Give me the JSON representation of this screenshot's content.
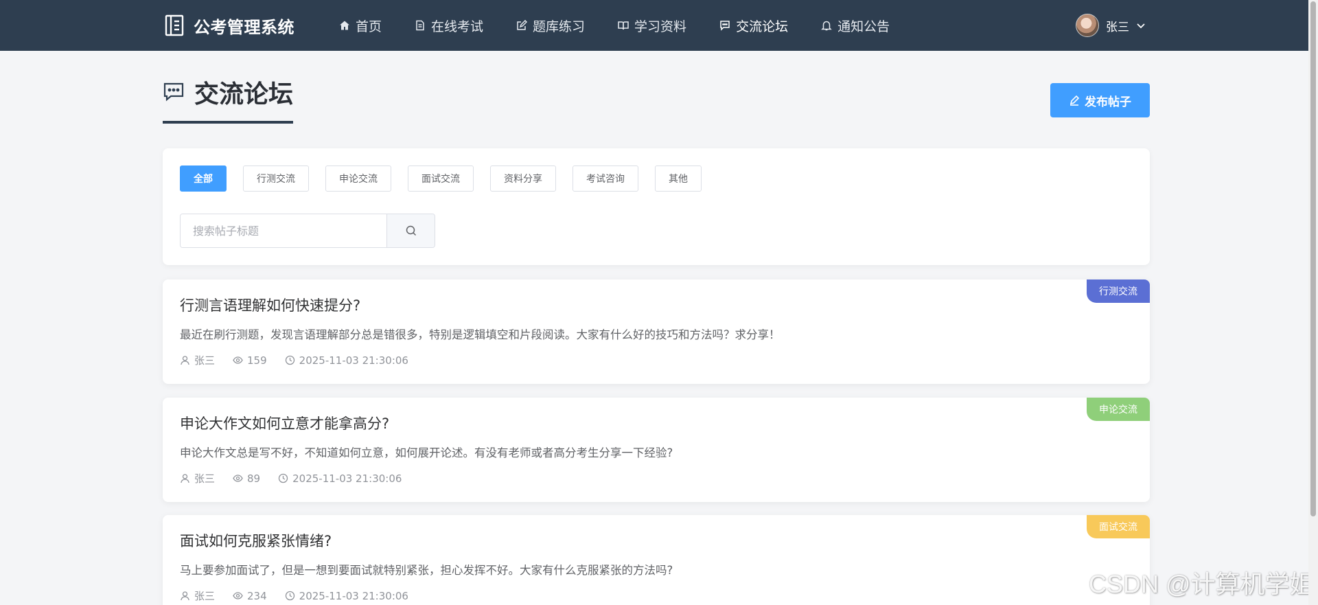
{
  "header": {
    "brand": "公考管理系统",
    "nav": [
      {
        "label": "首页",
        "icon": "home-icon"
      },
      {
        "label": "在线考试",
        "icon": "document-icon"
      },
      {
        "label": "题库练习",
        "icon": "edit-icon"
      },
      {
        "label": "学习资料",
        "icon": "book-icon"
      },
      {
        "label": "交流论坛",
        "icon": "chat-icon",
        "active": true
      },
      {
        "label": "通知公告",
        "icon": "bell-icon"
      }
    ],
    "user": {
      "name": "张三"
    }
  },
  "page": {
    "title": "交流论坛",
    "publish_label": "发布帖子"
  },
  "filters": {
    "categories": [
      "全部",
      "行测交流",
      "申论交流",
      "面试交流",
      "资料分享",
      "考试咨询",
      "其他"
    ],
    "active": "全部",
    "search_placeholder": "搜索帖子标题"
  },
  "posts": [
    {
      "title": "行测言语理解如何快速提分?",
      "body": "最近在刷行测题，发现言语理解部分总是错很多，特别是逻辑填空和片段阅读。大家有什么好的技巧和方法吗？求分享！",
      "author": "张三",
      "views": "159",
      "time": "2025-11-03 21:30:06",
      "tag": "行测交流",
      "tag_color": "#5b6fd4"
    },
    {
      "title": "申论大作文如何立意才能拿高分?",
      "body": "申论大作文总是写不好，不知道如何立意，如何展开论述。有没有老师或者高分考生分享一下经验?",
      "author": "张三",
      "views": "89",
      "time": "2025-11-03 21:30:06",
      "tag": "申论交流",
      "tag_color": "#8fcf7a"
    },
    {
      "title": "面试如何克服紧张情绪?",
      "body": "马上要参加面试了，但是一想到要面试就特别紧张，担心发挥不好。大家有什么克服紧张的方法吗?",
      "author": "张三",
      "views": "234",
      "time": "2025-11-03 21:30:06",
      "tag": "面试交流",
      "tag_color": "#f8c95a"
    }
  ],
  "watermark": "CSDN @计算机学姐"
}
